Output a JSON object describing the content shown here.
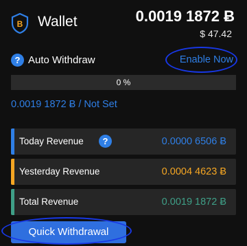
{
  "header": {
    "logo_icon": "bitcoin-shield-icon",
    "title": "Wallet",
    "balance_btc": "0.0019 1872 Ƀ",
    "balance_usd": "$ 47.42"
  },
  "auto_withdraw": {
    "help_icon": "question-icon",
    "help_glyph": "?",
    "label": "Auto Withdraw",
    "enable_label": "Enable Now",
    "progress_percent": 0,
    "progress_text": "0 %",
    "threshold_text": "0.0019 1872 Ƀ / Not Set"
  },
  "revenue": [
    {
      "label": "Today Revenue",
      "value": "0.0000 6506 Ƀ",
      "accent": "#2f7fe6",
      "has_help": true,
      "help_glyph": "?"
    },
    {
      "label": "Yesterday Revenue",
      "value": "0.0004 4623 Ƀ",
      "accent": "#f5a623"
    },
    {
      "label": "Total Revenue",
      "value": "0.0019 1872 Ƀ",
      "accent": "#3f9f87"
    }
  ],
  "actions": {
    "quick_withdrawal_label": "Quick Withdrawal"
  },
  "colors": {
    "background": "#101010",
    "primary_blue": "#2f7fe6",
    "orange": "#f5a623",
    "teal": "#3f9f87",
    "highlight_ring": "#1838e6"
  }
}
